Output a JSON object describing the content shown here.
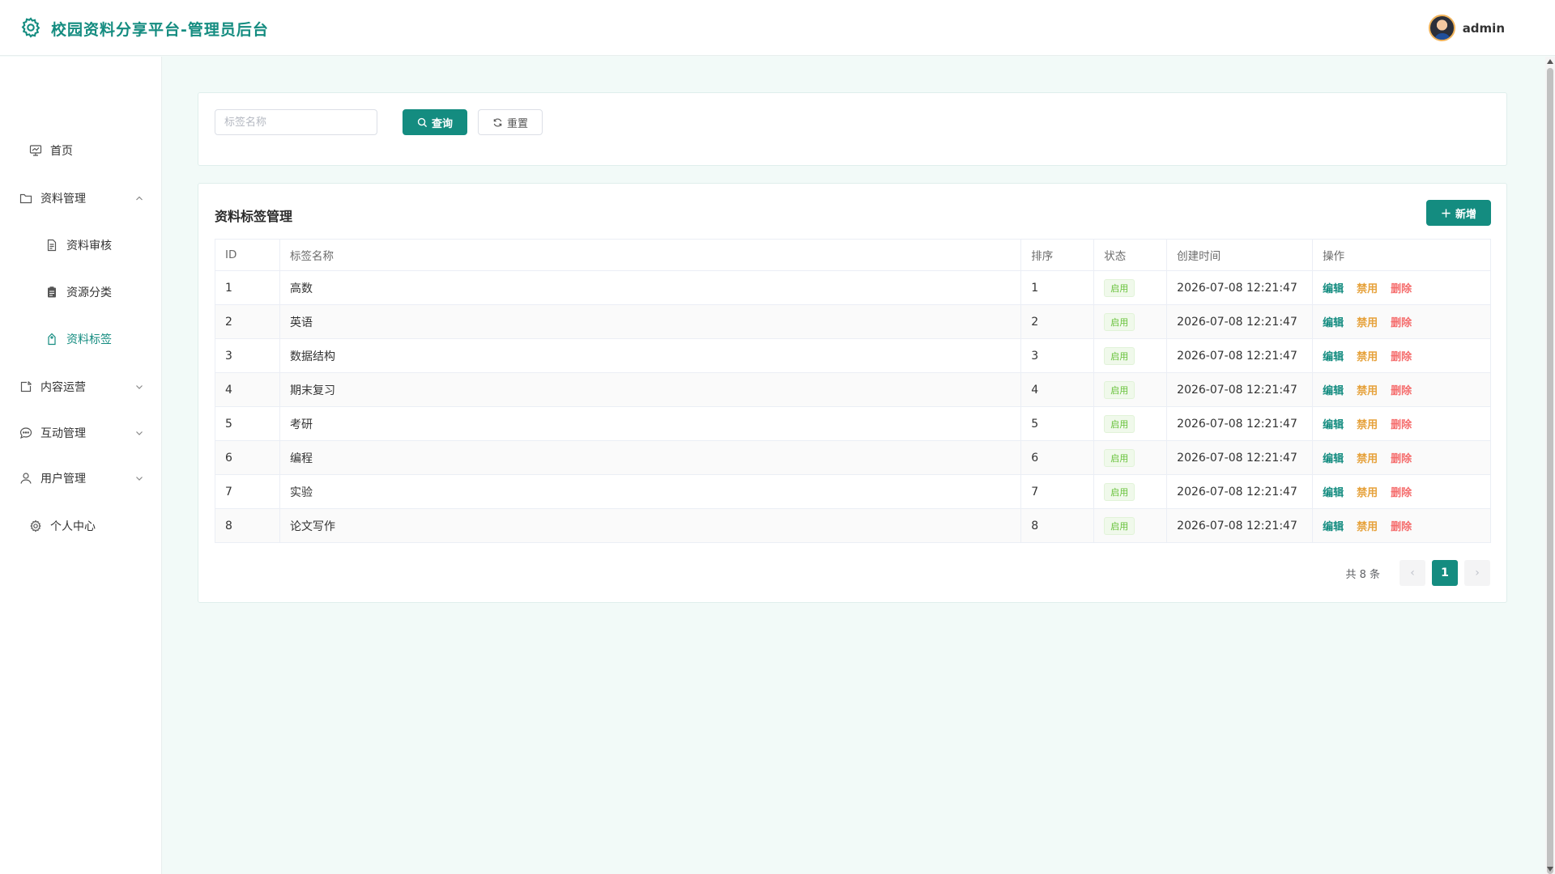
{
  "header": {
    "title": "校园资料分享平台-管理员后台",
    "username": "admin"
  },
  "sidebar": {
    "items": [
      {
        "label": "首页",
        "icon": "home-icon"
      },
      {
        "label": "资料管理",
        "icon": "folder-icon",
        "expanded": true
      },
      {
        "label": "资料审核",
        "icon": "document-icon"
      },
      {
        "label": "资源分类",
        "icon": "clipboard-icon"
      },
      {
        "label": "资料标签",
        "icon": "tag-icon",
        "active": true
      },
      {
        "label": "内容运营",
        "icon": "content-icon"
      },
      {
        "label": "互动管理",
        "icon": "chat-icon"
      },
      {
        "label": "用户管理",
        "icon": "user-icon"
      },
      {
        "label": "个人中心",
        "icon": "gear-icon"
      }
    ]
  },
  "search": {
    "placeholder": "标签名称",
    "query_label": "查询",
    "reset_label": "重置"
  },
  "table": {
    "title": "资料标签管理",
    "add_label": "新增",
    "columns": [
      "ID",
      "标签名称",
      "排序",
      "状态",
      "创建时间",
      "操作"
    ],
    "rows": [
      {
        "id": "1",
        "name": "高数",
        "sort": "1",
        "status": "启用",
        "created": "2026-07-08 12:21:47"
      },
      {
        "id": "2",
        "name": "英语",
        "sort": "2",
        "status": "启用",
        "created": "2026-07-08 12:21:47"
      },
      {
        "id": "3",
        "name": "数据结构",
        "sort": "3",
        "status": "启用",
        "created": "2026-07-08 12:21:47"
      },
      {
        "id": "4",
        "name": "期末复习",
        "sort": "4",
        "status": "启用",
        "created": "2026-07-08 12:21:47"
      },
      {
        "id": "5",
        "name": "考研",
        "sort": "5",
        "status": "启用",
        "created": "2026-07-08 12:21:47"
      },
      {
        "id": "6",
        "name": "编程",
        "sort": "6",
        "status": "启用",
        "created": "2026-07-08 12:21:47"
      },
      {
        "id": "7",
        "name": "实验",
        "sort": "7",
        "status": "启用",
        "created": "2026-07-08 12:21:47"
      },
      {
        "id": "8",
        "name": "论文写作",
        "sort": "8",
        "status": "启用",
        "created": "2026-07-08 12:21:47"
      }
    ],
    "actions": {
      "edit": "编辑",
      "disable": "禁用",
      "delete": "删除"
    }
  },
  "pagination": {
    "total_text": "共 8 条",
    "current_page": "1",
    "prev": "‹",
    "next": "›"
  },
  "colors": {
    "accent": "#148c80",
    "status_green": "#67c23a",
    "disable_orange": "#e6a23c",
    "delete_red": "#f56c6c"
  }
}
